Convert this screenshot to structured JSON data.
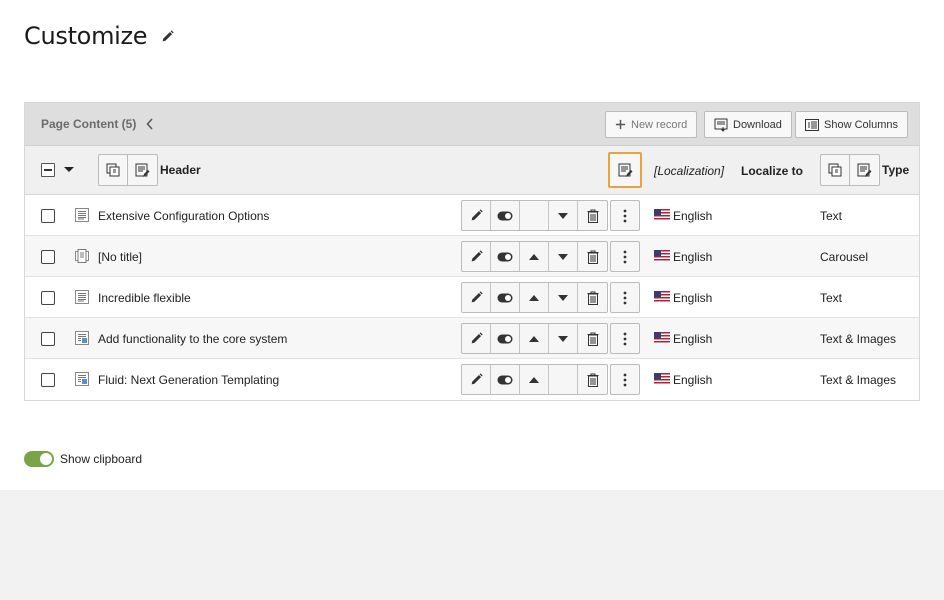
{
  "page": {
    "title": "Customize"
  },
  "panel": {
    "title": "Page Content (5)",
    "buttons": {
      "new_record": "New record",
      "download": "Download",
      "show_columns": "Show Columns"
    }
  },
  "columns": {
    "header": "Header",
    "localization": "[Localization]",
    "localize_to": "Localize to",
    "type": "Type"
  },
  "rows": [
    {
      "title": "Extensive Configuration Options",
      "icon": "text-content-icon",
      "language": "English",
      "type": "Text",
      "move_up": false,
      "move_down": true
    },
    {
      "title": "[No title]",
      "icon": "carousel-content-icon",
      "language": "English",
      "type": "Carousel",
      "move_up": true,
      "move_down": true
    },
    {
      "title": "Incredible flexible",
      "icon": "text-content-icon",
      "language": "English",
      "type": "Text",
      "move_up": true,
      "move_down": true
    },
    {
      "title": "Add functionality to the core system",
      "icon": "text-image-content-icon",
      "language": "English",
      "type": "Text & Images",
      "move_up": true,
      "move_down": true
    },
    {
      "title": "Fluid: Next Generation Templating",
      "icon": "text-image-content-icon",
      "language": "English",
      "type": "Text & Images",
      "move_up": true,
      "move_down": false
    }
  ],
  "clipboard": {
    "label": "Show clipboard",
    "enabled": true
  },
  "colors": {
    "focus": "#e8a33d",
    "toggle_on": "#79a548",
    "panel_header": "#dedede"
  }
}
